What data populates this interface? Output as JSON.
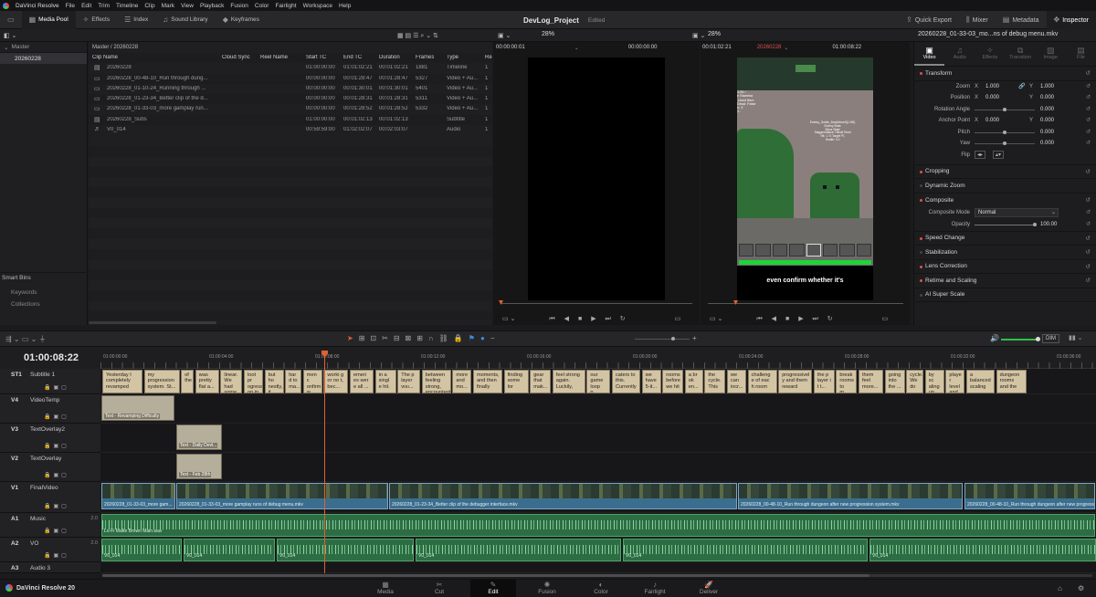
{
  "menubar": {
    "app": "DaVinci Resolve",
    "items": [
      "File",
      "Edit",
      "Trim",
      "Timeline",
      "Clip",
      "Mark",
      "View",
      "Playback",
      "Fusion",
      "Color",
      "Fairlight",
      "Workspace",
      "Help"
    ]
  },
  "toolbar": {
    "media_pool": "Media Pool",
    "effects": "Effects",
    "index": "Index",
    "sound_library": "Sound Library",
    "keyframes": "Keyframes",
    "project_title": "DevLog_Project",
    "edited": "Edited",
    "quick_export": "Quick Export",
    "mixer": "Mixer",
    "metadata": "Metadata",
    "inspector": "Inspector"
  },
  "viewer_bar": {
    "src_zoom": "28%",
    "tl_zoom": "28%",
    "src_tc": "00:00:00:01",
    "src_tc2": "00:00:00:00",
    "tl_tc": "00:01:02:21",
    "tl_name": "20260228",
    "tl_tc2": "01:00:08:22",
    "clip_name": "20260228_01-33-03_mo...ns of debug menu.mkv"
  },
  "sidebar": {
    "master": "Master",
    "selected": "20260228",
    "smart_bins": "Smart Bins",
    "keywords": "Keywords",
    "collections": "Collections"
  },
  "media": {
    "breadcrumb": "Master / 20260228",
    "headers": [
      "Clip Name",
      "Cloud Sync",
      "Reel Name",
      "Start TC",
      "End TC",
      "Duration",
      "Frames",
      "Type",
      "Re"
    ],
    "rows": [
      {
        "icon": "timeline-icon",
        "name": "20260228",
        "start": "01:00:00:00",
        "end": "01:01:02:21",
        "dur": "00:01:02:21",
        "frames": "1881",
        "type": "Timeline",
        "re": "1"
      },
      {
        "icon": "video-icon",
        "name": "20260228_00-48-10_Run through dung...",
        "start": "00:00:00:00",
        "end": "00:01:28:47",
        "dur": "00:01:28:47",
        "frames": "5327",
        "type": "Video + Au...",
        "re": "1"
      },
      {
        "icon": "video-icon",
        "name": "20260228_01-10-24_Running through ...",
        "start": "00:00:00:00",
        "end": "00:01:30:01",
        "dur": "00:01:30:01",
        "frames": "5401",
        "type": "Video + Au...",
        "re": "1"
      },
      {
        "icon": "video-icon",
        "name": "20260228_01-23-34_Better clip of the d...",
        "start": "00:00:00:00",
        "end": "00:01:28:31",
        "dur": "00:01:28:31",
        "frames": "5311",
        "type": "Video + Au...",
        "re": "1"
      },
      {
        "icon": "video-icon",
        "name": "20260228_01-33-03_more gamplay run...",
        "start": "00:00:00:00",
        "end": "00:01:28:52",
        "dur": "00:01:28:52",
        "frames": "5332",
        "type": "Video + Au...",
        "re": "1"
      },
      {
        "icon": "subtitle-icon",
        "name": "20260228_Subs",
        "start": "01:00:00:00",
        "end": "00:01:02:13",
        "dur": "00:01:02:13",
        "frames": "",
        "type": "Subtitle",
        "re": "1"
      },
      {
        "icon": "audio-icon",
        "name": "V0_014",
        "start": "00:59:59:00",
        "end": "01:02:02:07",
        "dur": "00:02:03:07",
        "frames": "",
        "type": "Audio",
        "re": "1"
      }
    ]
  },
  "preview": {
    "hud": "1:26 /\ne Stamina\n Used Item\nDead: False\nn: 3\n1 :",
    "debug": "Enemy_Goblin_BodyMoveD(LI:59)\nEnemy State\nSince State\nStagger/Attack: Hitsoft Rush\nHit: 1 / 0 Target P1\nHealth: 0.0",
    "caption": "even confirm whether it's"
  },
  "inspector": {
    "tabs": [
      "Video",
      "Audio",
      "Effects",
      "Transition",
      "Image",
      "File"
    ],
    "transform": "Transform",
    "zoom_label": "Zoom",
    "zoom_x": "1.000",
    "zoom_y": "1.000",
    "position_label": "Position",
    "pos_x": "0.000",
    "pos_y": "0.000",
    "rotation_label": "Rotation Angle",
    "rotation": "0.000",
    "anchor_label": "Anchor Point",
    "anchor_x": "0.000",
    "anchor_y": "0.000",
    "pitch_label": "Pitch",
    "pitch": "0.000",
    "yaw_label": "Yaw",
    "yaw": "0.000",
    "flip_label": "Flip",
    "cropping": "Cropping",
    "dynamic_zoom": "Dynamic Zoom",
    "composite": "Composite",
    "composite_mode_label": "Composite Mode",
    "composite_mode": "Normal",
    "opacity_label": "Opacity",
    "opacity": "100.00",
    "speed_change": "Speed Change",
    "stabilization": "Stabilization",
    "lens_correction": "Lens Correction",
    "retime": "Retime and Scaling",
    "super_scale": "AI Super Scale"
  },
  "timeline": {
    "timecode": "01:00:08:22",
    "ruler": [
      "01:00:00:00",
      "01:00:04:00",
      "01:00:08:00",
      "01:00:12:00",
      "01:00:16:00",
      "01:00:20:00",
      "01:00:24:00",
      "01:00:28:00",
      "01:00:32:00",
      "01:00:36:00"
    ],
    "dim": "DIM",
    "tracks": {
      "st1": "ST1",
      "st1_name": "Subtitle 1",
      "v4": "V4",
      "v4_name": "VideoTemp",
      "v3": "V3",
      "v3_name": "TextOverlay2",
      "v2": "V2",
      "v2_name": "TextOverlay",
      "v1": "V1",
      "v1_name": "FinalVideo",
      "a1": "A1",
      "a1_name": "Music",
      "a2": "A2",
      "a2_name": "VO",
      "a3": "A3",
      "a3_name": "Audio 3",
      "level": "2.0"
    },
    "subtitles": [
      "Yesterday I completely revamped",
      "my progression system. St...",
      "of the",
      "was pretty flat a...",
      "linear. We had some",
      "loot pr ogressi on in ...",
      "but ho nestly, it was ...",
      "har d to ma...",
      "men c onfirm w het...",
      "worki g or no t, bec...",
      "emeri es wer e all ...",
      "in a singl e hit.",
      "The p layer vısı...",
      "between feeling strong, encountering",
      "more and mo...",
      "moments, and then finally",
      "finding some lor",
      "gear that mak...",
      "feel strong again. Luckily,",
      "our game loop p...",
      "caters to this. Currently",
      "we have 5-it...",
      "rooms before we hit",
      "a br ok en...",
      "the cycle. This ...",
      "we can incr...",
      "challeng e of eac h room",
      "progressivel y and them reward",
      "the p layer i t t...",
      "break rooms to m...",
      "them feel more...",
      "going into the ...",
      "cycle. We do ...",
      "by sc aling up ...",
      "playe r level and ...",
      "a balanced scaling ...",
      "dungeon rooms and the"
    ],
    "v4_clip": "Text - Revamping Difficulty",
    "v3_clip": "Text - Daily Devl...",
    "v2_clip": "Text - Feb 28th",
    "v1_clips": [
      "20260228_01-33-03_more gam...",
      "20260228_01-33-03_more gamplay runs of debug menu.mkv",
      "20260228_01-23-34_Better clip of the debugger interface.mkv",
      "20260228_00-48-10_Run through dungeon after new progression system.mkv",
      "20260228_00-48-10_Run through dungeon after new progression..."
    ],
    "a1_clip": "Lo-Fi Matte Brown Main.wav",
    "a2_clip": "V0_014"
  },
  "pages": [
    "Media",
    "Cut",
    "Edit",
    "Fusion",
    "Color",
    "Fairlight",
    "Deliver"
  ],
  "footer": {
    "app": "DaVinci Resolve 20"
  }
}
